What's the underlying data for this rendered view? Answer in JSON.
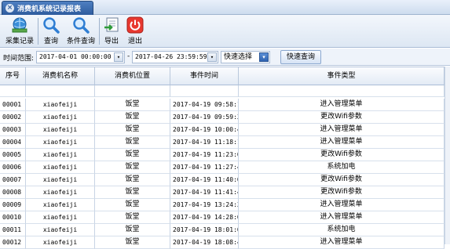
{
  "tab": {
    "title": "消费机系统记录报表",
    "close_icon": "close-icon"
  },
  "toolbar": {
    "buttons": [
      {
        "label": "采集记录",
        "icon": "globe-collect-icon"
      },
      {
        "label": "查询",
        "icon": "magnifier-icon"
      },
      {
        "label": "条件查询",
        "icon": "magnifier-icon"
      },
      {
        "label": "导出",
        "icon": "export-icon"
      },
      {
        "label": "退出",
        "icon": "power-icon"
      }
    ]
  },
  "filter": {
    "label": "时间范围:",
    "from": "2017-04-01 00:00:00",
    "dash": "-",
    "to": "2017-04-26 23:59:59",
    "quick_select": "快速选择",
    "quick_query": "快速查询"
  },
  "table": {
    "columns": [
      "序号",
      "消费机名称",
      "消费机位置",
      "事件时间",
      "事件类型"
    ],
    "rows": [
      [
        "00001",
        "xiaofeiji",
        "饭堂",
        "2017-04-19 09:58:18",
        "进入管理菜单"
      ],
      [
        "00002",
        "xiaofeiji",
        "饭堂",
        "2017-04-19 09:59:33",
        "更改Wifi参数"
      ],
      [
        "00003",
        "xiaofeiji",
        "饭堂",
        "2017-04-19 10:00:44",
        "进入管理菜单"
      ],
      [
        "00004",
        "xiaofeiji",
        "饭堂",
        "2017-04-19 11:18:17",
        "进入管理菜单"
      ],
      [
        "00005",
        "xiaofeiji",
        "饭堂",
        "2017-04-19 11:23:05",
        "更改Wifi参数"
      ],
      [
        "00006",
        "xiaofeiji",
        "饭堂",
        "2017-04-19 11:27:45",
        "系统加电"
      ],
      [
        "00007",
        "xiaofeiji",
        "饭堂",
        "2017-04-19 11:40:08",
        "更改Wifi参数"
      ],
      [
        "00008",
        "xiaofeiji",
        "饭堂",
        "2017-04-19 11:41:43",
        "更改Wifi参数"
      ],
      [
        "00009",
        "xiaofeiji",
        "饭堂",
        "2017-04-19 13:24:30",
        "进入管理菜单"
      ],
      [
        "00010",
        "xiaofeiji",
        "饭堂",
        "2017-04-19 14:28:08",
        "进入管理菜单"
      ],
      [
        "00011",
        "xiaofeiji",
        "饭堂",
        "2017-04-19 18:01:00",
        "系统加电"
      ],
      [
        "00012",
        "xiaofeiji",
        "饭堂",
        "2017-04-19 18:08:49",
        "进入管理菜单"
      ]
    ]
  }
}
